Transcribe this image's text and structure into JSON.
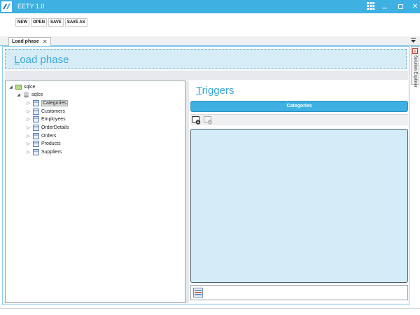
{
  "app": {
    "title": "EETY 1.0",
    "accent": "#3eb0e2"
  },
  "window_controls": {
    "apps": "grid-icon",
    "minimize": "minimize",
    "maximize": "maximize",
    "close": "✕"
  },
  "toolbar": {
    "new": "NEW",
    "open": "OPEN",
    "save": "SAVE",
    "save_as": "SAVE AS"
  },
  "tab": {
    "label": "Load phase",
    "close": "✕"
  },
  "header": {
    "first": "L",
    "rest": "oad phase"
  },
  "tree": {
    "root": "sqlce",
    "db": "sqlce",
    "tables": [
      "Categories",
      "Customers",
      "Employees",
      "OrderDetails",
      "Orders",
      "Products",
      "Suppliers"
    ]
  },
  "triggers": {
    "first": "T",
    "rest": "riggers",
    "selected_table": "Categories"
  },
  "side_panel": {
    "label": "Solution Explorer"
  }
}
